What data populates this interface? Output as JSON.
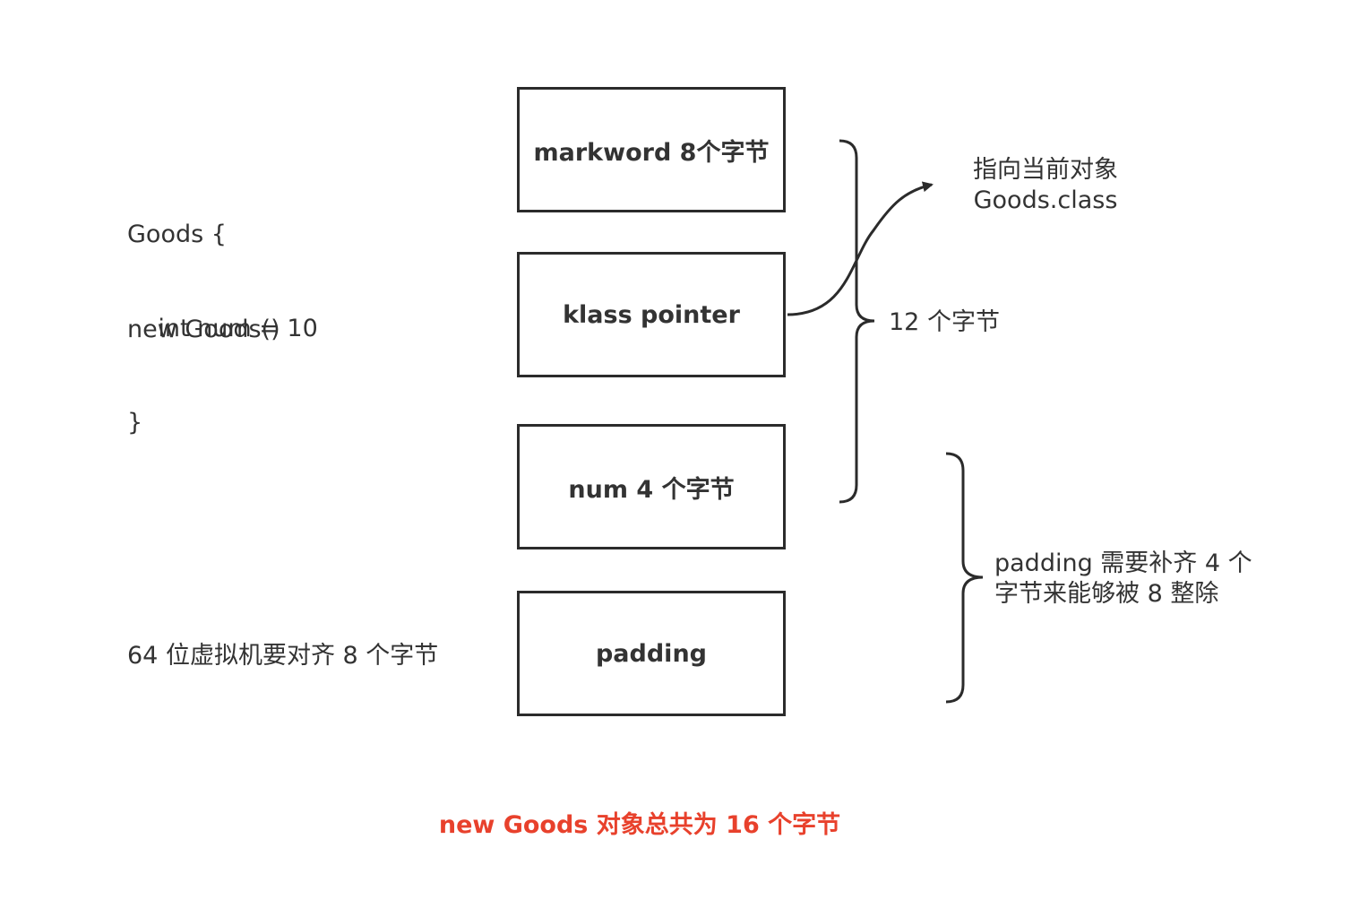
{
  "code": {
    "line1": "Goods {",
    "line2": "    int num = 10",
    "line3": "}"
  },
  "new_expression": "new Goods()",
  "alignment_note": "64 位虚拟机要对齐 8 个字节",
  "boxes": [
    {
      "label": "markword 8个字节"
    },
    {
      "label": "klass pointer"
    },
    {
      "label": "num 4 个字节"
    },
    {
      "label": "padding"
    }
  ],
  "pointer_note": {
    "line1": "指向当前对象",
    "line2": "Goods.class"
  },
  "header_size_label": "12 个字节",
  "padding_note": {
    "line1": "padding 需要补齐 4 个",
    "line2": "字节来能够被 8 整除"
  },
  "total_note": "new Goods 对象总共为 16 个字节",
  "colors": {
    "stroke": "#2b2b2b",
    "text": "#333333",
    "highlight": "#e8412c"
  }
}
